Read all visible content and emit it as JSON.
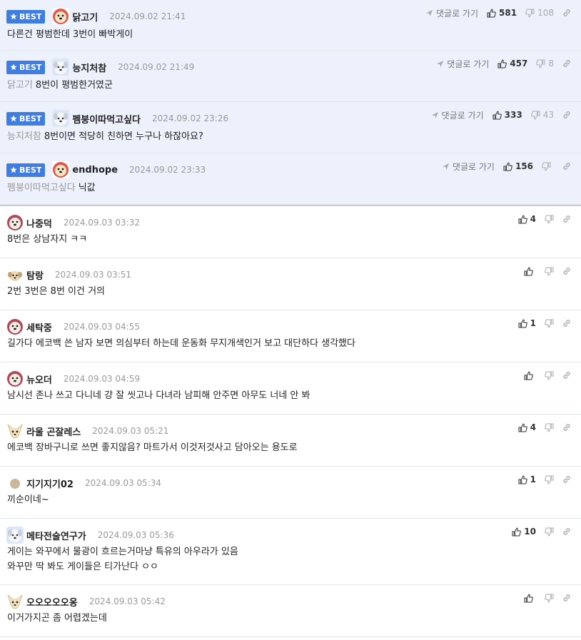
{
  "best_label": "BEST",
  "goto_label": "댓글로 가기",
  "best_comments": [
    {
      "nick": "닭고기",
      "date": "2024.09.02 21:41",
      "reply_to": "",
      "text": "다른건 평범한데 3번이 빠박게이",
      "up": "581",
      "down": "108",
      "avatar": "dog-red"
    },
    {
      "nick": "능지처참",
      "date": "2024.09.02 21:49",
      "reply_to": "닭고기",
      "text": "8번이 평범한거였군",
      "up": "457",
      "down": "8",
      "avatar": "dog-white"
    },
    {
      "nick": "펨붕이따먹고싶다",
      "date": "2024.09.02 23:26",
      "reply_to": "능지처참",
      "text": "8번이면 적당히 친하면 누구나 하잖아요?",
      "up": "333",
      "down": "43",
      "avatar": "dog-white"
    },
    {
      "nick": "endhope",
      "date": "2024.09.02 23:33",
      "reply_to": "펨붕이따먹고싶다",
      "text": "닉값",
      "up": "156",
      "down": "",
      "avatar": "dog-red"
    }
  ],
  "comments": [
    {
      "nick": "나중덕",
      "date": "2024.09.03 03:32",
      "text": "8번은 상남자지 ㅋㅋ",
      "up": "4",
      "avatar": "dog-pink"
    },
    {
      "nick": "탐랑",
      "date": "2024.09.03 03:51",
      "text": "2번 3번은 8번 이건 거의",
      "up": "",
      "avatar": "puppy"
    },
    {
      "nick": "세탁중",
      "date": "2024.09.03 04:55",
      "text": "길가다 에코백 쓴 남자 보면 의심부터 하는데 운동화 무지개색인거 보고 대단하다 생각했다",
      "up": "1",
      "avatar": "dog-pink"
    },
    {
      "nick": "뉴오더",
      "date": "2024.09.03 04:59",
      "text": "남시선 존나 쓰고 다니네 걍 잘 씻고나 다녀라 남피해 안주면 아무도 너네 안 봐",
      "up": "",
      "avatar": "dog-pink"
    },
    {
      "nick": "라울 곤잘레스",
      "date": "2024.09.03 05:21",
      "text": "에코백 장바구니로 쓰면 좋지않음? 마트가서 이것저것사고 담아오는 용도로",
      "up": "4",
      "avatar": "chihuahua"
    },
    {
      "nick": "지기지기02",
      "date": "2024.09.03 05:34",
      "text": "끼순이네~",
      "up": "1",
      "avatar": "dot"
    },
    {
      "nick": "메타전술연구가",
      "date": "2024.09.03 05:36",
      "text": "게이는 와꾸에서 물광이 흐르는거마냥 특유의 아우라가 있음\n와꾸만 딱 봐도 게이들은 티가난다 ㅇㅇ",
      "up": "10",
      "avatar": "dog-white"
    },
    {
      "nick": "오오오오오옹",
      "date": "2024.09.03 05:42",
      "text": "이거가지곤 좀 어렵겠는데",
      "up": "",
      "avatar": "chihuahua"
    }
  ]
}
